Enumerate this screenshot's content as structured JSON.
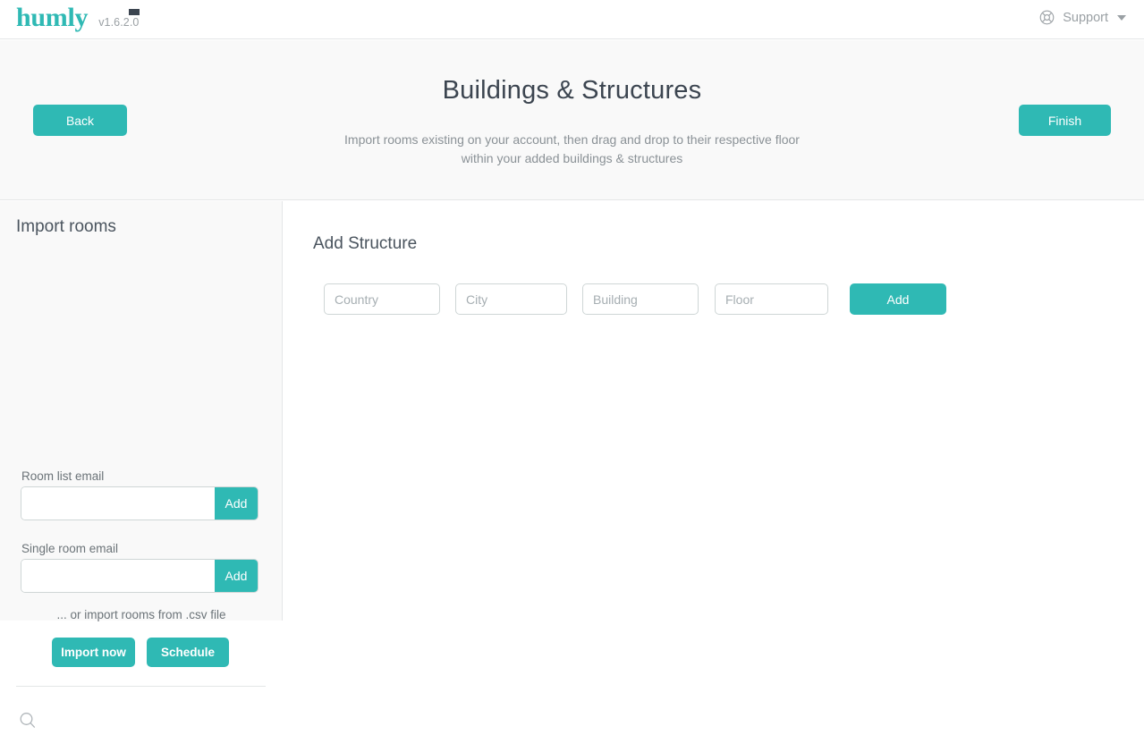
{
  "topbar": {
    "logo_text": "humly",
    "version": "v1.6.2.0",
    "support_label": "Support",
    "support_icon": "lifebuoy-icon",
    "dropdown_icon": "chevron-down-icon"
  },
  "hero": {
    "title": "Buildings & Structures",
    "subtitle_line1": "Import rooms existing on your account, then drag and drop to their respective floor",
    "subtitle_line2": "within your added buildings & structures",
    "back_label": "Back",
    "finish_label": "Finish"
  },
  "sidebar": {
    "title": "Import rooms",
    "room_list": {
      "label": "Room list email",
      "value": "",
      "placeholder": "",
      "add_label": "Add"
    },
    "single_room": {
      "label": "Single room email",
      "value": "",
      "placeholder": "",
      "add_label": "Add"
    },
    "csv_note": "... or import rooms from .csv file",
    "import_now_label": "Import now",
    "schedule_label": "Schedule",
    "search_icon": "search-icon"
  },
  "main": {
    "title": "Add Structure",
    "fields": {
      "country_placeholder": "Country",
      "country_value": "",
      "city_placeholder": "City",
      "city_value": "",
      "building_placeholder": "Building",
      "building_value": "",
      "floor_placeholder": "Floor",
      "floor_value": ""
    },
    "add_label": "Add"
  },
  "colors": {
    "accent": "#2fb9b4",
    "hero_bg": "#f9f9f9",
    "sidebar_bg": "#f9f9f9",
    "border": "#e4e6e7",
    "title_text": "#3c4550",
    "muted_text": "#8a9196"
  }
}
